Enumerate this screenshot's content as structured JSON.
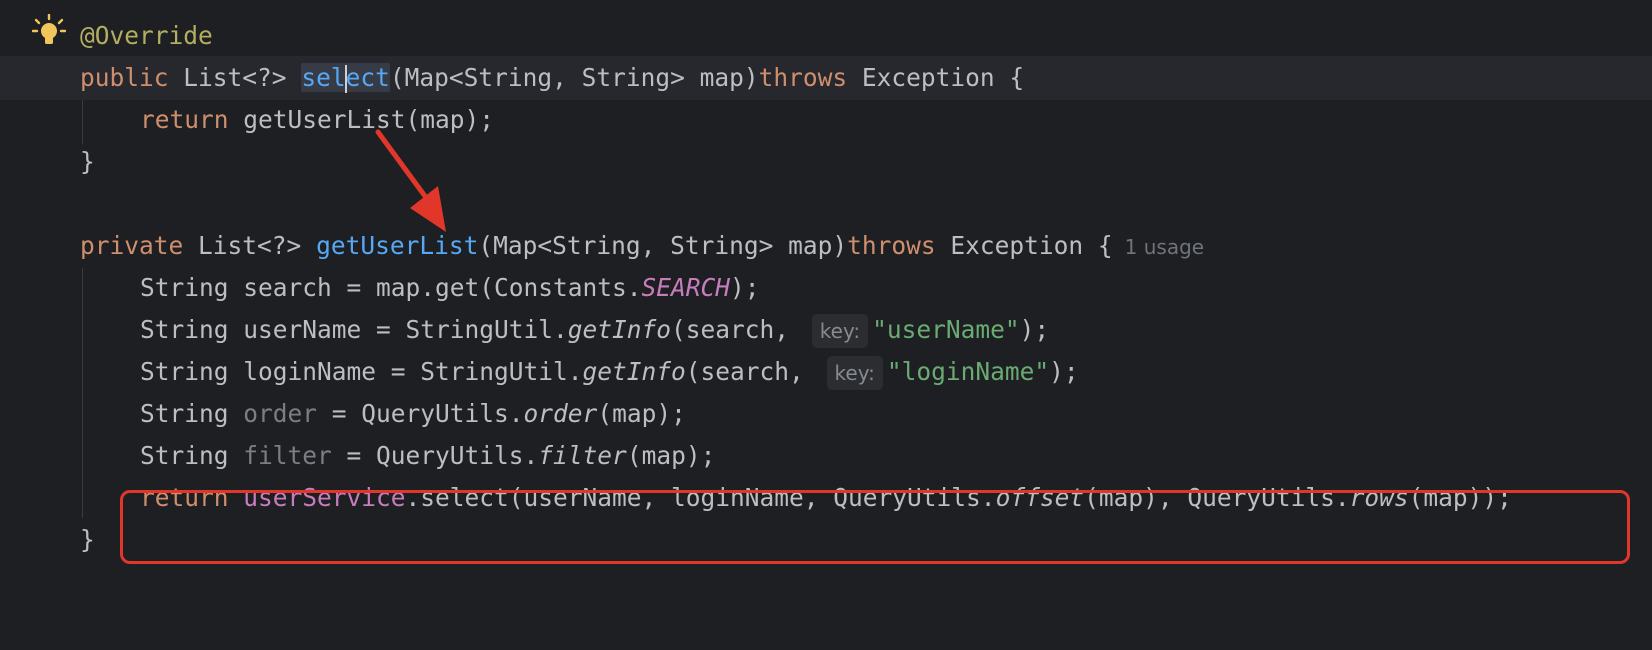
{
  "editor": {
    "lines": [
      {
        "annotation": "@Override"
      },
      {
        "kw_public": "public",
        "type_list": "List<?>",
        "fn_before_caret": "sel",
        "fn_after_caret": "ect",
        "params": "(Map<String, String> map)",
        "kw_throws": "throws",
        "exception": "Exception {"
      },
      {
        "kw_return": "return",
        "call": "getUserList(map);"
      },
      {
        "brace": "}"
      },
      {
        "kw_private": "private",
        "type_list": "List<?>",
        "fn_name": "getUserList",
        "params": "(Map<String, String> map)",
        "kw_throws": "throws",
        "exception": "Exception {",
        "usage": "1 usage"
      },
      {
        "before": "String search = map.get(Constants.",
        "const": "SEARCH",
        "after": ");"
      },
      {
        "before": "String userName = StringUtil.",
        "method": "getInfo",
        "mid": "(search, ",
        "hint": "key:",
        "str": "\"userName\"",
        "after": ");"
      },
      {
        "before": "String loginName = StringUtil.",
        "method": "getInfo",
        "mid": "(search, ",
        "hint": "key:",
        "str": "\"loginName\"",
        "after": ");"
      },
      {
        "type": "String ",
        "var": "order",
        "mid": " = QueryUtils.",
        "method": "order",
        "after": "(map);"
      },
      {
        "type": "String ",
        "var": "filter",
        "mid": " = QueryUtils.",
        "method": "filter",
        "after": "(map);"
      },
      {
        "kw_return": "return",
        "field": "userService",
        "part1": ".select(userName, loginName, QueryUtils.",
        "method1": "offset",
        "part2": "(map), QueryUtils.",
        "method2": "rows",
        "part3": "(map));"
      },
      {
        "brace": "}"
      }
    ]
  },
  "colors": {
    "background": "#1e1f22",
    "keyword": "#cf8e6d",
    "function": "#56a8f5",
    "string": "#6aab73",
    "field": "#c77dbb",
    "annotation": "#b3ae60",
    "annotation_arrow": "#e0372a"
  },
  "icons": {
    "gutter": "lightbulb-icon"
  }
}
